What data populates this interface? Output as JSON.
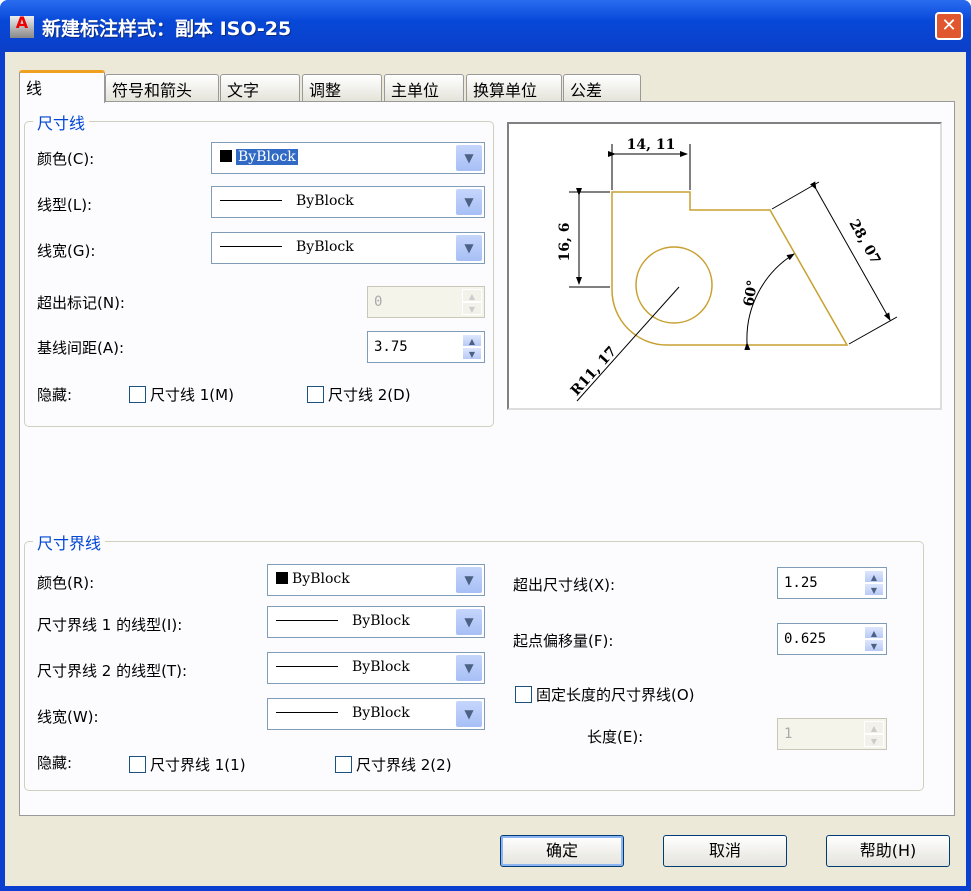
{
  "window": {
    "title": "新建标注样式：副本 ISO-25",
    "app_icon": "A",
    "close": "✕"
  },
  "tabs": [
    "线",
    "符号和箭头",
    "文字",
    "调整",
    "主单位",
    "换算单位",
    "公差"
  ],
  "dim_lines": {
    "group": "尺寸线",
    "color_label": "颜色(C):",
    "color_value": "ByBlock",
    "linetype_label": "线型(L):",
    "linetype_value": "ByBlock",
    "lineweight_label": "线宽(G):",
    "lineweight_value": "ByBlock",
    "extend_label": "超出标记(N):",
    "extend_value": "0",
    "baseline_label": "基线间距(A):",
    "baseline_value": "3.75",
    "suppress_label": "隐藏:",
    "suppress1": "尺寸线 1(M)",
    "suppress2": "尺寸线 2(D)"
  },
  "preview": {
    "dim_top": "14, 11",
    "dim_left": "16, 6",
    "dim_diag": "28, 07",
    "angle": "60°",
    "radius": "R11, 17",
    "colors": {
      "outline": "#c8a030",
      "dim": "#000000"
    }
  },
  "ext_lines": {
    "group": "尺寸界线",
    "color_label": "颜色(R):",
    "color_value": "ByBlock",
    "lt1_label": "尺寸界线 1 的线型(I):",
    "lt1_value": "ByBlock",
    "lt2_label": "尺寸界线 2 的线型(T):",
    "lt2_value": "ByBlock",
    "lineweight_label": "线宽(W):",
    "lineweight_value": "ByBlock",
    "suppress_label": "隐藏:",
    "suppress1": "尺寸界线 1(1)",
    "suppress2": "尺寸界线 2(2)",
    "beyond_label": "超出尺寸线(X):",
    "beyond_value": "1.25",
    "offset_label": "起点偏移量(F):",
    "offset_value": "0.625",
    "fixed_label": "固定长度的尺寸界线(O)",
    "length_label": "长度(E):",
    "length_value": "1"
  },
  "buttons": {
    "ok": "确定",
    "cancel": "取消",
    "help": "帮助(H)"
  }
}
